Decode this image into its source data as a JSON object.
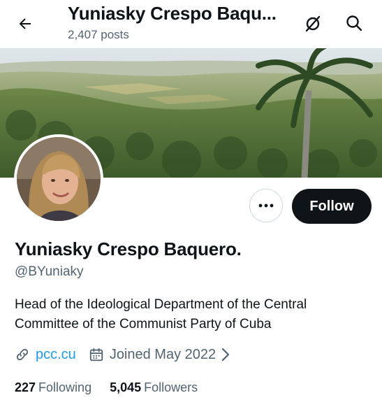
{
  "header": {
    "title": "Yuniasky Crespo Baqu...",
    "posts_count": "2,407 posts"
  },
  "profile": {
    "name": "Yuniasky Crespo Baquero.",
    "handle": "@BYuniaky",
    "bio": "Head of the Ideological Department of the Central Committee of the Communist Party of Cuba",
    "website": "pcc.cu",
    "joined": "Joined May 2022"
  },
  "actions": {
    "follow_label": "Follow"
  },
  "stats": {
    "following_count": "227",
    "following_label": "Following",
    "followers_count": "5,045",
    "followers_label": "Followers"
  },
  "icons": {
    "back": "arrow-left-icon",
    "grok": "grok-icon",
    "search": "search-icon",
    "more": "more-horizontal-icon",
    "link": "link-icon",
    "calendar": "calendar-icon",
    "chevron": "chevron-right-icon"
  },
  "colors": {
    "text_primary": "#0f1419",
    "text_secondary": "#536471",
    "link": "#1d9bf0",
    "follow_bg": "#0f1419",
    "border": "#cfd9de"
  }
}
